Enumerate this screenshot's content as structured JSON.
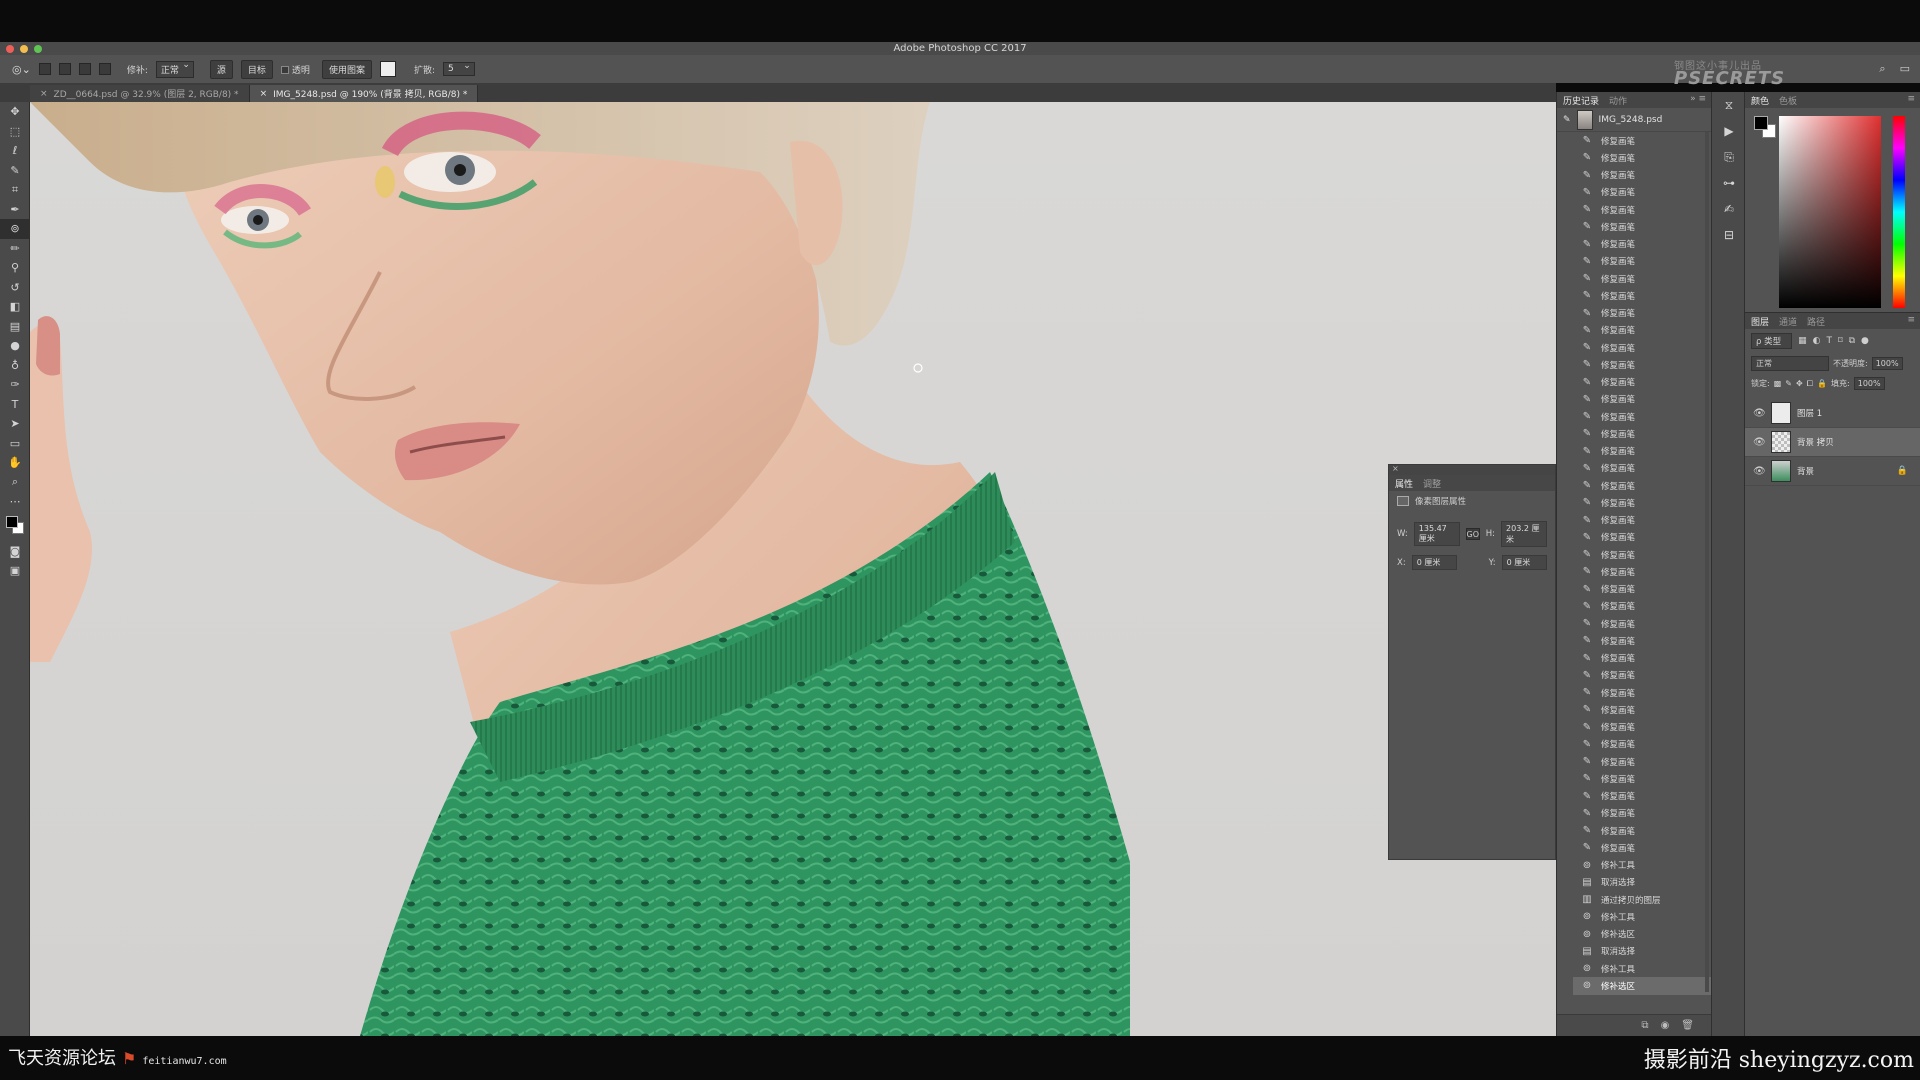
{
  "app": {
    "title": "Adobe Photoshop CC 2017"
  },
  "options_bar": {
    "patch_label": "修补:",
    "mode_value": "正常",
    "source_label": "源",
    "dest_label": "目标",
    "transparent_label": "透明",
    "use_pattern_label": "使用图案",
    "diffusion_label": "扩散:",
    "diffusion_value": "5"
  },
  "brand": {
    "line1": "钢图这小事儿出品",
    "line2": "PSECRETS"
  },
  "tabs": [
    {
      "label": "ZD__0664.psd @ 32.9% (图层 2, RGB/8) *",
      "active": false
    },
    {
      "label": "IMG_5248.psd @ 190% (背景 拷贝, RGB/8) *",
      "active": true
    }
  ],
  "properties_panel": {
    "tab_properties": "属性",
    "tab_adjustments": "调整",
    "section_title": "像素图层属性",
    "w_label": "W:",
    "w_value": "135.47 厘米",
    "h_label": "H:",
    "h_value": "203.2 厘米",
    "x_label": "X:",
    "x_value": "0 厘米",
    "y_label": "Y:",
    "y_value": "0 厘米",
    "link_glyph": "GO"
  },
  "history_panel": {
    "tab_history": "历史记录",
    "tab_actions": "动作",
    "snapshot_name": "IMG_5248.psd",
    "items": [
      {
        "label": "修复画笔",
        "icon": "healing-brush-icon"
      },
      {
        "label": "修复画笔",
        "icon": "healing-brush-icon"
      },
      {
        "label": "修复画笔",
        "icon": "healing-brush-icon"
      },
      {
        "label": "修复画笔",
        "icon": "healing-brush-icon"
      },
      {
        "label": "修复画笔",
        "icon": "healing-brush-icon"
      },
      {
        "label": "修复画笔",
        "icon": "healing-brush-icon"
      },
      {
        "label": "修复画笔",
        "icon": "healing-brush-icon"
      },
      {
        "label": "修复画笔",
        "icon": "healing-brush-icon"
      },
      {
        "label": "修复画笔",
        "icon": "healing-brush-icon"
      },
      {
        "label": "修复画笔",
        "icon": "healing-brush-icon"
      },
      {
        "label": "修复画笔",
        "icon": "healing-brush-icon"
      },
      {
        "label": "修复画笔",
        "icon": "healing-brush-icon"
      },
      {
        "label": "修复画笔",
        "icon": "healing-brush-icon"
      },
      {
        "label": "修复画笔",
        "icon": "healing-brush-icon"
      },
      {
        "label": "修复画笔",
        "icon": "healing-brush-icon"
      },
      {
        "label": "修复画笔",
        "icon": "healing-brush-icon"
      },
      {
        "label": "修复画笔",
        "icon": "healing-brush-icon"
      },
      {
        "label": "修复画笔",
        "icon": "healing-brush-icon"
      },
      {
        "label": "修复画笔",
        "icon": "healing-brush-icon"
      },
      {
        "label": "修复画笔",
        "icon": "healing-brush-icon"
      },
      {
        "label": "修复画笔",
        "icon": "healing-brush-icon"
      },
      {
        "label": "修复画笔",
        "icon": "healing-brush-icon"
      },
      {
        "label": "修复画笔",
        "icon": "healing-brush-icon"
      },
      {
        "label": "修复画笔",
        "icon": "healing-brush-icon"
      },
      {
        "label": "修复画笔",
        "icon": "healing-brush-icon"
      },
      {
        "label": "修复画笔",
        "icon": "healing-brush-icon"
      },
      {
        "label": "修复画笔",
        "icon": "healing-brush-icon"
      },
      {
        "label": "修复画笔",
        "icon": "healing-brush-icon"
      },
      {
        "label": "修复画笔",
        "icon": "healing-brush-icon"
      },
      {
        "label": "修复画笔",
        "icon": "healing-brush-icon"
      },
      {
        "label": "修复画笔",
        "icon": "healing-brush-icon"
      },
      {
        "label": "修复画笔",
        "icon": "healing-brush-icon"
      },
      {
        "label": "修复画笔",
        "icon": "healing-brush-icon"
      },
      {
        "label": "修复画笔",
        "icon": "healing-brush-icon"
      },
      {
        "label": "修复画笔",
        "icon": "healing-brush-icon"
      },
      {
        "label": "修复画笔",
        "icon": "healing-brush-icon"
      },
      {
        "label": "修复画笔",
        "icon": "healing-brush-icon"
      },
      {
        "label": "修复画笔",
        "icon": "healing-brush-icon"
      },
      {
        "label": "修复画笔",
        "icon": "healing-brush-icon"
      },
      {
        "label": "修复画笔",
        "icon": "healing-brush-icon"
      },
      {
        "label": "修复画笔",
        "icon": "healing-brush-icon"
      },
      {
        "label": "修复画笔",
        "icon": "healing-brush-icon"
      },
      {
        "label": "修补工具",
        "icon": "patch-tool-icon"
      },
      {
        "label": "取消选择",
        "icon": "deselect-icon"
      },
      {
        "label": "通过拷贝的图层",
        "icon": "layer-via-copy-icon"
      },
      {
        "label": "修补工具",
        "icon": "patch-tool-icon"
      },
      {
        "label": "修补选区",
        "icon": "patch-selection-icon"
      },
      {
        "label": "取消选择",
        "icon": "deselect-icon"
      },
      {
        "label": "修补工具",
        "icon": "patch-tool-icon"
      },
      {
        "label": "修补选区",
        "icon": "patch-selection-icon",
        "active": true
      }
    ]
  },
  "color_panel": {
    "tab_color": "颜色",
    "tab_swatches": "色板"
  },
  "layers_panel": {
    "tab_layers": "图层",
    "tab_channels": "通道",
    "tab_paths": "路径",
    "filter_label": "ρ 类型",
    "blend_mode": "正常",
    "opacity_label": "不透明度:",
    "opacity_value": "100%",
    "lock_label": "锁定:",
    "fill_label": "填充:",
    "fill_value": "100%",
    "layers": [
      {
        "name": "图层 1",
        "thumb": "white",
        "active": false,
        "locked": false
      },
      {
        "name": "背景 拷贝",
        "thumb": "checker",
        "active": true,
        "locked": false
      },
      {
        "name": "背景",
        "thumb": "photo",
        "active": false,
        "locked": true
      }
    ]
  },
  "watermarks": {
    "left_cn": "飞天资源论坛",
    "left_url": "feitianwu7.com",
    "right": "摄影前沿 sheyingzyz.com"
  }
}
